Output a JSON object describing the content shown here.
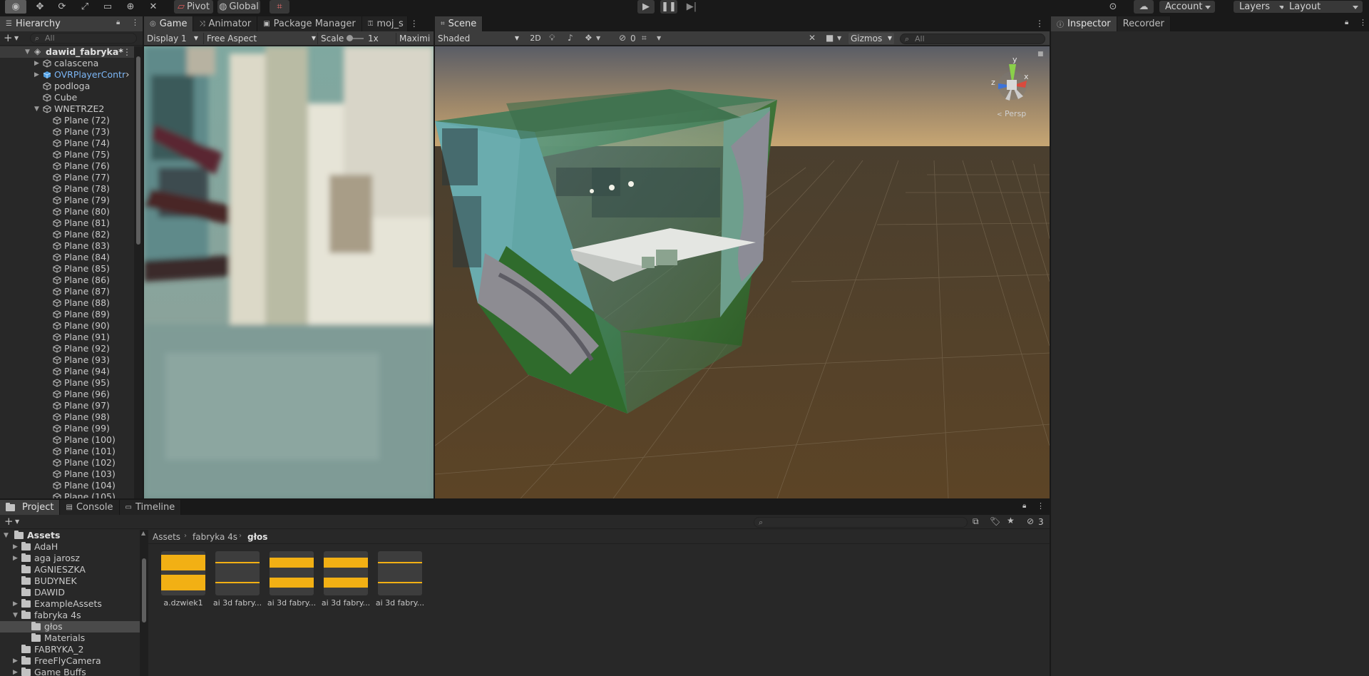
{
  "toolbar": {
    "pivot": "Pivot",
    "global": "Global",
    "account": "Account",
    "layers": "Layers",
    "layout": "Layout"
  },
  "hierarchy": {
    "tab": "Hierarchy",
    "search_placeholder": "All",
    "scene": "dawid_fabryka*",
    "items": [
      {
        "label": "calascena",
        "level": 1,
        "expand": "closed"
      },
      {
        "label": "OVRPlayerContr",
        "level": 1,
        "expand": "closed",
        "prefab": true
      },
      {
        "label": "podloga",
        "level": 1
      },
      {
        "label": "Cube",
        "level": 1
      },
      {
        "label": "WNETRZE2",
        "level": 1,
        "expand": "open"
      },
      {
        "label": "Plane (72)",
        "level": 2
      },
      {
        "label": "Plane (73)",
        "level": 2
      },
      {
        "label": "Plane (74)",
        "level": 2
      },
      {
        "label": "Plane (75)",
        "level": 2
      },
      {
        "label": "Plane (76)",
        "level": 2
      },
      {
        "label": "Plane (77)",
        "level": 2
      },
      {
        "label": "Plane (78)",
        "level": 2
      },
      {
        "label": "Plane (79)",
        "level": 2
      },
      {
        "label": "Plane (80)",
        "level": 2
      },
      {
        "label": "Plane (81)",
        "level": 2
      },
      {
        "label": "Plane (82)",
        "level": 2
      },
      {
        "label": "Plane (83)",
        "level": 2
      },
      {
        "label": "Plane (84)",
        "level": 2
      },
      {
        "label": "Plane (85)",
        "level": 2
      },
      {
        "label": "Plane (86)",
        "level": 2
      },
      {
        "label": "Plane (87)",
        "level": 2
      },
      {
        "label": "Plane (88)",
        "level": 2
      },
      {
        "label": "Plane (89)",
        "level": 2
      },
      {
        "label": "Plane (90)",
        "level": 2
      },
      {
        "label": "Plane (91)",
        "level": 2
      },
      {
        "label": "Plane (92)",
        "level": 2
      },
      {
        "label": "Plane (93)",
        "level": 2
      },
      {
        "label": "Plane (94)",
        "level": 2
      },
      {
        "label": "Plane (95)",
        "level": 2
      },
      {
        "label": "Plane (96)",
        "level": 2
      },
      {
        "label": "Plane (97)",
        "level": 2
      },
      {
        "label": "Plane (98)",
        "level": 2
      },
      {
        "label": "Plane (99)",
        "level": 2
      },
      {
        "label": "Plane (100)",
        "level": 2
      },
      {
        "label": "Plane (101)",
        "level": 2
      },
      {
        "label": "Plane (102)",
        "level": 2
      },
      {
        "label": "Plane (103)",
        "level": 2
      },
      {
        "label": "Plane (104)",
        "level": 2
      },
      {
        "label": "Plane (105)",
        "level": 2
      }
    ]
  },
  "game": {
    "tabs": [
      "Game",
      "Animator",
      "Package Manager",
      "moj_s"
    ],
    "display": "Display 1",
    "aspect": "Free Aspect",
    "scale_label": "Scale",
    "scale_value": "1x",
    "maximize": "Maximi"
  },
  "scene": {
    "tab": "Scene",
    "shading": "Shaded",
    "mode_2d": "2D",
    "hidden_count": "0",
    "gizmos": "Gizmos",
    "search_placeholder": "All",
    "persp": "Persp",
    "axis_y": "y",
    "axis_z": "z",
    "axis_x": "x"
  },
  "inspector": {
    "tabs": [
      "Inspector",
      "Recorder"
    ]
  },
  "project": {
    "tabs": [
      "Project",
      "Console",
      "Timeline"
    ],
    "hidden_count": "3",
    "root": "Assets",
    "folders": [
      {
        "label": "AdaH",
        "level": 1,
        "expand": "closed"
      },
      {
        "label": "aga jarosz",
        "level": 1,
        "expand": "closed"
      },
      {
        "label": "AGNIESZKA",
        "level": 1
      },
      {
        "label": "BUDYNEK",
        "level": 1
      },
      {
        "label": "DAWID",
        "level": 1
      },
      {
        "label": "ExampleAssets",
        "level": 1,
        "expand": "closed"
      },
      {
        "label": "fabryka 4s",
        "level": 1,
        "expand": "open",
        "open": true
      },
      {
        "label": "głos",
        "level": 2,
        "selected": true
      },
      {
        "label": "Materials",
        "level": 2
      },
      {
        "label": "FABRYKA_2",
        "level": 1
      },
      {
        "label": "FreeFlyCamera",
        "level": 1,
        "expand": "closed"
      },
      {
        "label": "Game Buffs",
        "level": 1,
        "expand": "closed"
      }
    ],
    "breadcrumb": [
      "Assets",
      "fabryka 4s",
      "głos"
    ],
    "assets": [
      {
        "label": "a.dzwiek1",
        "amp": 0.9
      },
      {
        "label": "ai 3d fabry...",
        "amp": 0.12
      },
      {
        "label": "ai 3d fabry...",
        "amp": 0.55
      },
      {
        "label": "ai 3d fabry...",
        "amp": 0.55
      },
      {
        "label": "ai 3d fabry...",
        "amp": 0.1
      }
    ]
  },
  "colors": {
    "accent": "#2c5d87",
    "prefab_text": "#7cb6f5",
    "audio_wave": "#f2b014"
  }
}
